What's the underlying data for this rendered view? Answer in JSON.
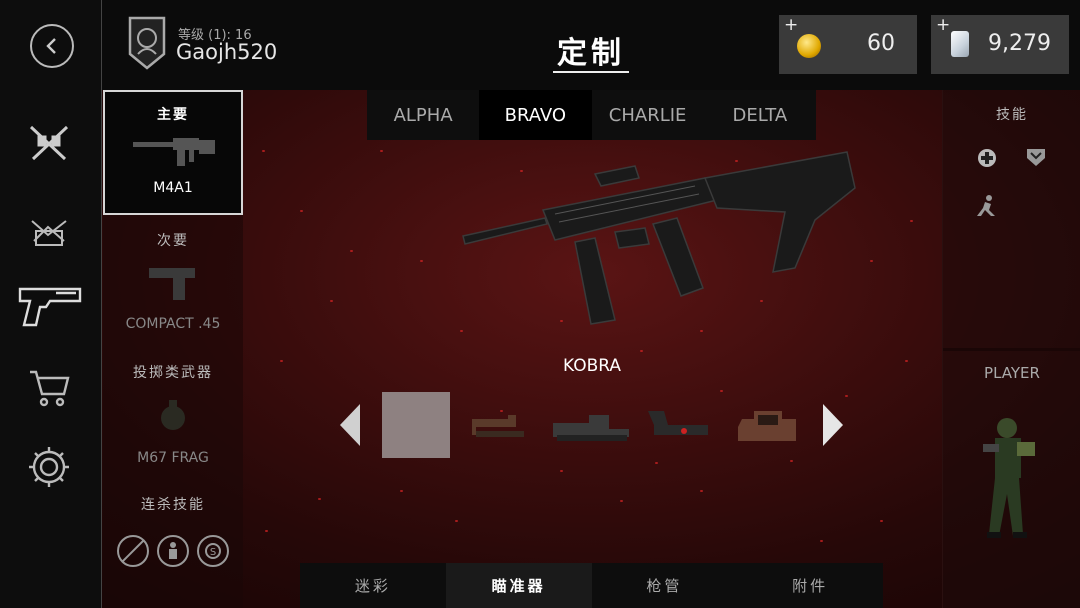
{
  "header": {
    "title": "定制",
    "player": {
      "rank_label": "等级 (1): 16",
      "name": "Gaojh520"
    },
    "currency": {
      "gold": {
        "plus": "+",
        "value": "60"
      },
      "cards": {
        "plus": "+",
        "value": "9,279"
      }
    }
  },
  "nav": {
    "items": [
      {
        "icon": "back-arrow-icon"
      },
      {
        "icon": "crossed-rifles-icon"
      },
      {
        "icon": "target-crates-icon"
      },
      {
        "icon": "pistol-icon",
        "active": true
      },
      {
        "icon": "shopping-cart-icon"
      },
      {
        "icon": "gear-icon"
      }
    ]
  },
  "weapon_slots": [
    {
      "category": "主要",
      "weapon": "M4A1",
      "selected": true
    },
    {
      "category": "次要",
      "weapon": "COMPACT .45"
    },
    {
      "category": "投掷类武器",
      "weapon": "M67 FRAG"
    },
    {
      "category": "连杀技能",
      "weapon": ""
    }
  ],
  "loadout_tabs": [
    {
      "label": "ALPHA"
    },
    {
      "label": "BRAVO",
      "active": true
    },
    {
      "label": "CHARLIE"
    },
    {
      "label": "DELTA"
    }
  ],
  "attachment": {
    "selected_name": "KOBRA",
    "options": [
      "empty",
      "red-dot-sight",
      "holo-sight",
      "reflex-sight",
      "eotech-sight"
    ]
  },
  "skills": {
    "title": "技能"
  },
  "player_section": {
    "title": "PLAYER"
  },
  "bottom_tabs": [
    {
      "label": "迷彩"
    },
    {
      "label": "瞄准器",
      "active": true
    },
    {
      "label": "枪管"
    },
    {
      "label": "附件"
    }
  ]
}
